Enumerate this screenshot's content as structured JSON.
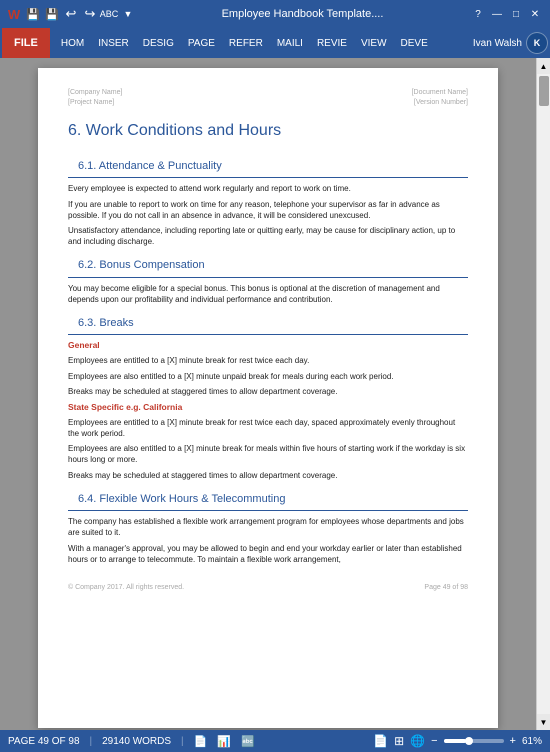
{
  "titleBar": {
    "title": "Employee Handbook Template....",
    "icons": [
      "💾",
      "💾",
      "↩",
      "↪",
      "ABC",
      "⚙"
    ],
    "windowControls": [
      "?",
      "—",
      "□",
      "✕"
    ]
  },
  "ribbon": {
    "fileLabel": "FILE",
    "tabs": [
      "HOM",
      "INSER",
      "DESIG",
      "PAGE",
      "REFER",
      "MAILI",
      "REVIE",
      "VIEW",
      "DEVE"
    ],
    "user": "Ivan Walsh",
    "userInitial": "K"
  },
  "pageMeta": {
    "leftLine1": "[Company Name]",
    "leftLine2": "[Project Name]",
    "rightLine1": "[Document Name]",
    "rightLine2": "[Version Number]"
  },
  "content": {
    "section6Title": "6.   Work Conditions and Hours",
    "section61": {
      "heading": "6.1.     Attendance & Punctuality",
      "para1": "Every employee is expected to attend work regularly and report to work on time.",
      "para2": "If you are unable to report to work on time for any reason, telephone your supervisor as far in advance as possible. If you do not call in an absence in advance, it will be considered unexcused.",
      "para3": "Unsatisfactory attendance, including reporting late or quitting early, may be cause for disciplinary action, up to and including discharge."
    },
    "section62": {
      "heading": "6.2.     Bonus Compensation",
      "para1": "You may become eligible for a special bonus. This bonus is optional at the discretion of management and depends upon our profitability and individual performance and contribution."
    },
    "section63": {
      "heading": "6.3.     Breaks",
      "generalLabel": "General",
      "para1": "Employees are entitled to a [X] minute break for rest twice each day.",
      "para2": "Employees are also entitled to a [X] minute unpaid break for meals during each work period.",
      "para3": "Breaks may be scheduled at staggered times to allow department coverage.",
      "stateLabel": "State Specific e.g. California",
      "para4": "Employees are entitled to a [X] minute break for rest twice each day, spaced approximately evenly throughout the work period.",
      "para5": "Employees are also entitled to a [X] minute break for meals within five hours of starting work if the workday is six hours long or more.",
      "para6": "Breaks may be scheduled at staggered times to allow department coverage."
    },
    "section64": {
      "heading": "6.4.     Flexible Work Hours & Telecommuting",
      "para1": "The company has established a flexible work arrangement program for employees whose departments and jobs are suited to it.",
      "para2": "With a manager's approval, you may be allowed to begin and end your workday earlier or later than established hours or to arrange to telecommute. To maintain a flexible work arrangement,"
    }
  },
  "footer": {
    "copyright": "© Company 2017. All rights reserved.",
    "pageInfo": "Page 49 of 98"
  },
  "statusBar": {
    "pageOf": "PAGE 49 OF 98",
    "wordCount": "29140 WORDS",
    "zoomPercent": "61%",
    "icons": [
      "📄",
      "📊",
      "🔤"
    ]
  }
}
